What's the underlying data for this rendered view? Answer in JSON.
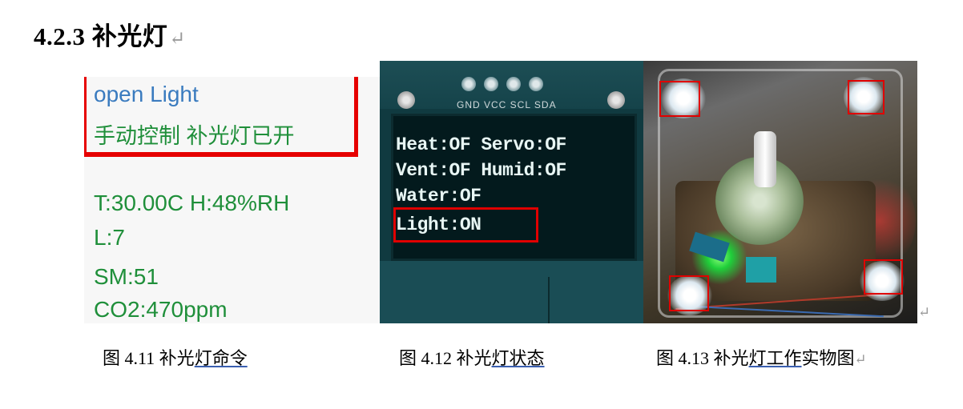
{
  "section": {
    "heading": "4.2.3 补光灯",
    "pilcrow": "↵"
  },
  "figure_4_11": {
    "command": "open Light",
    "reply": "手动控制 补光灯已开",
    "status_lines": [
      "T:30.00C H:48%RH",
      "L:7",
      "SM:51",
      "CO2:470ppm"
    ]
  },
  "figure_4_12": {
    "pin_labels": "GND VCC SCL SDA",
    "oled_lines": [
      "Heat:OF Servo:OF",
      "Vent:OF Humid:OF",
      "Water:OF",
      "Light:ON"
    ]
  },
  "figure_4_13": {},
  "captions": [
    {
      "prefix": "图 4.11 补光",
      "underlined": "灯命令",
      "suffix": "",
      "pilcrow": ""
    },
    {
      "prefix": "图 4.12 补光",
      "underlined": "灯状态",
      "suffix": "",
      "pilcrow": ""
    },
    {
      "prefix": "图 4.13 补光",
      "underlined": "灯工作",
      "suffix": "实物图",
      "pilcrow": "↵"
    }
  ],
  "trailing_pilcrow": "↵",
  "colors": {
    "highlight_red": "#e00000",
    "command_blue": "#3a7bbf",
    "reply_green": "#1f8f3a"
  }
}
